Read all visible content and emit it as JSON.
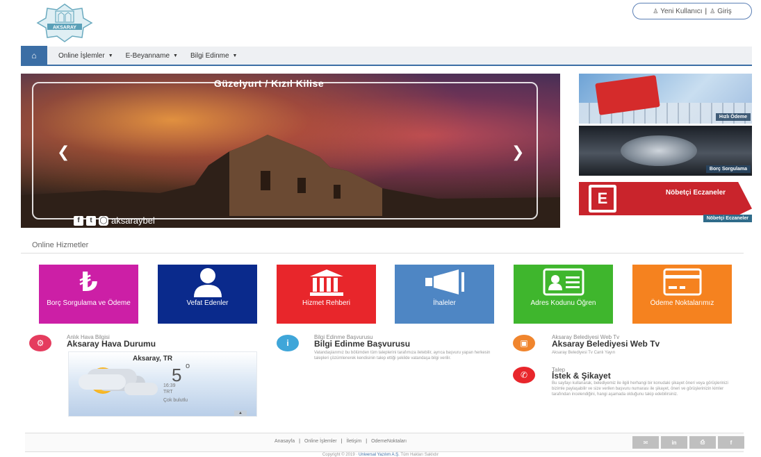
{
  "header": {
    "logo_text": "AKSARAY",
    "new_user_label": "Yeni Kullanıcı",
    "login_label": "Giriş"
  },
  "nav": {
    "items": [
      {
        "label": "Online İşlemler"
      },
      {
        "label": "E-Beyanname"
      },
      {
        "label": "Bilgi Edinme"
      }
    ]
  },
  "slider": {
    "title": "Güzelyurt / Kızıl Kilise",
    "handle": "aksaraybel"
  },
  "side_cards": {
    "card1_label": "Hızlı Ödeme",
    "card2_label": "Borç Sorgulama",
    "card3_title": "Nöbetçi Eczaneler",
    "card3_label": "Nöbetçi Eczaneler"
  },
  "services": {
    "title": "Online Hizmetler",
    "tiles": [
      {
        "label": "Borç Sorgulama ve Ödeme",
        "color": "#cc1fa6",
        "icon": "lira-icon"
      },
      {
        "label": "Vefat Edenler",
        "color": "#0a2a8c",
        "icon": "person-icon"
      },
      {
        "label": "Hizmet Rehberi",
        "color": "#e8262b",
        "icon": "building-icon"
      },
      {
        "label": "İhaleler",
        "color": "#4e86c4",
        "icon": "megaphone-icon"
      },
      {
        "label": "Adres Kodunu Öğren",
        "color": "#3fb62d",
        "icon": "id-card-icon"
      },
      {
        "label": "Ödeme Noktalarımız",
        "color": "#f5821f",
        "icon": "credit-card-icon"
      }
    ]
  },
  "weather_panel": {
    "small": "Anlık Hava Bilgisi",
    "title": "Aksaray Hava Durumu",
    "city": "Aksaray, TR",
    "temp": "5",
    "deg": "o",
    "time": "16:39",
    "tz": "TRT",
    "condition": "Çok bulutlu"
  },
  "bilgi_panel": {
    "small": "Bilgi Edinme Başvurusu",
    "title": "Bilgi Edinme Başvurusu",
    "desc": "Vatandaşlarımız bu bölümden tüm taleplerini tarafımıza iletebilir, ayrıca başvuru yapan herkesin talepleri çözümlenerek kendisinin talep ettiği şekilde vatandaşa bilgi verilir."
  },
  "webtv_panel": {
    "small": "Aksaray Belediyesi Web Tv",
    "title": "Aksaray Belediyesi Web Tv",
    "desc": "Aksaray Belediyesi Tv Canlı Yayın"
  },
  "talep_panel": {
    "small": "Talep",
    "title": "İstek & Şikayet",
    "desc": "Bu sayfayı kullanarak, belediyemiz ile ilgili herhangi bir konudaki şikayet öneri veya görüşlerinizi bizimle paylaşabilir ve size verilen başvuru numarası ile şikayet, öneri ve görüşlerinizin kimler tarafından incelendiğini, hangi aşamada olduğunu takip edebilirsiniz."
  },
  "footer": {
    "links": [
      "Anasayfa",
      "Online İşlemler",
      "İletişim",
      "OdemeNoktaları"
    ],
    "copyright_prefix": "Copyright © 2019 ·",
    "brand": "Universal Yazılım A.Ş.",
    "copyright_suffix": "Tüm Hakları Saklıdır"
  },
  "colors": {
    "nav_accent": "#3b6ea5",
    "weather_icon": "#e53c5e",
    "bilgi_icon": "#3fa6d9",
    "webtv_icon": "#f0852d",
    "talep_icon": "#e8262b"
  }
}
